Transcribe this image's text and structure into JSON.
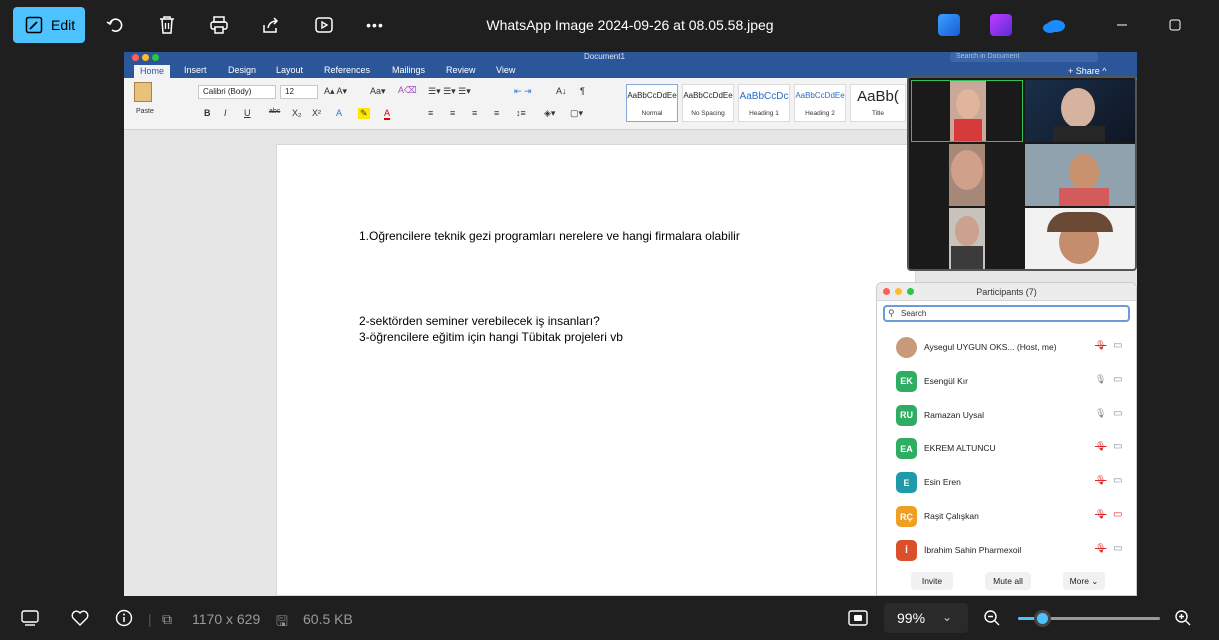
{
  "topbar": {
    "edit_label": "Edit",
    "title": "WhatsApp Image 2024-09-26 at 08.05.58.jpeg",
    "more_label": "•••"
  },
  "word": {
    "doc_title": "Document1",
    "search_placeholder": "Search in Document",
    "share_label": "Share",
    "tabs": [
      "Home",
      "Insert",
      "Design",
      "Layout",
      "References",
      "Mailings",
      "Review",
      "View"
    ],
    "paste_label": "Paste",
    "font_name": "Calibri (Body)",
    "font_size": "12",
    "styles": [
      {
        "sample": "AaBbCcDdEe",
        "name": "Normal"
      },
      {
        "sample": "AaBbCcDdEe",
        "name": "No Spacing"
      },
      {
        "sample": "AaBbCcDc",
        "name": "Heading 1"
      },
      {
        "sample": "AaBbCcDdEe",
        "name": "Heading 2"
      },
      {
        "sample": "AaBb(",
        "name": "Title"
      }
    ],
    "lines": [
      "1.Oğrencilere teknik gezi programları nerelere ve hangi firmalara olabilir",
      "2-sektörden seminer verebilecek iş insanları?",
      "3-öğrencilere eğitim için hangi Tübitak projeleri vb"
    ]
  },
  "participants": {
    "title": "Participants (7)",
    "search_value": "Search",
    "list": [
      {
        "initials": "",
        "name": "Aysegul UYGUN OKS...  (Host, me)",
        "color": "#c99a7a",
        "mic": "muted"
      },
      {
        "initials": "EK",
        "name": "Esengül Kır",
        "color": "#2fae63",
        "mic": "on"
      },
      {
        "initials": "RU",
        "name": "Ramazan Uysal",
        "color": "#2fae63",
        "mic": "on"
      },
      {
        "initials": "EA",
        "name": "EKREM ALTUNCU",
        "color": "#2fae63",
        "mic": "muted"
      },
      {
        "initials": "E",
        "name": "Esin Eren",
        "color": "#1e9aa8",
        "mic": "muted"
      },
      {
        "initials": "RÇ",
        "name": "Raşit Çalışkan",
        "color": "#f0a020",
        "mic": "muted"
      },
      {
        "initials": "İ",
        "name": "İbrahim Sahin Pharmexoil",
        "color": "#d9502b",
        "mic": "muted"
      }
    ],
    "invite_label": "Invite",
    "mute_all_label": "Mute all",
    "more_label": "More ⌄"
  },
  "bottombar": {
    "dimensions": "1170 x 629",
    "file_size": "60.5 KB",
    "zoom": "99%",
    "zoom_level": 0.17
  },
  "colors": {
    "accent": "#4cc2ff",
    "word_blue": "#2b579a"
  }
}
